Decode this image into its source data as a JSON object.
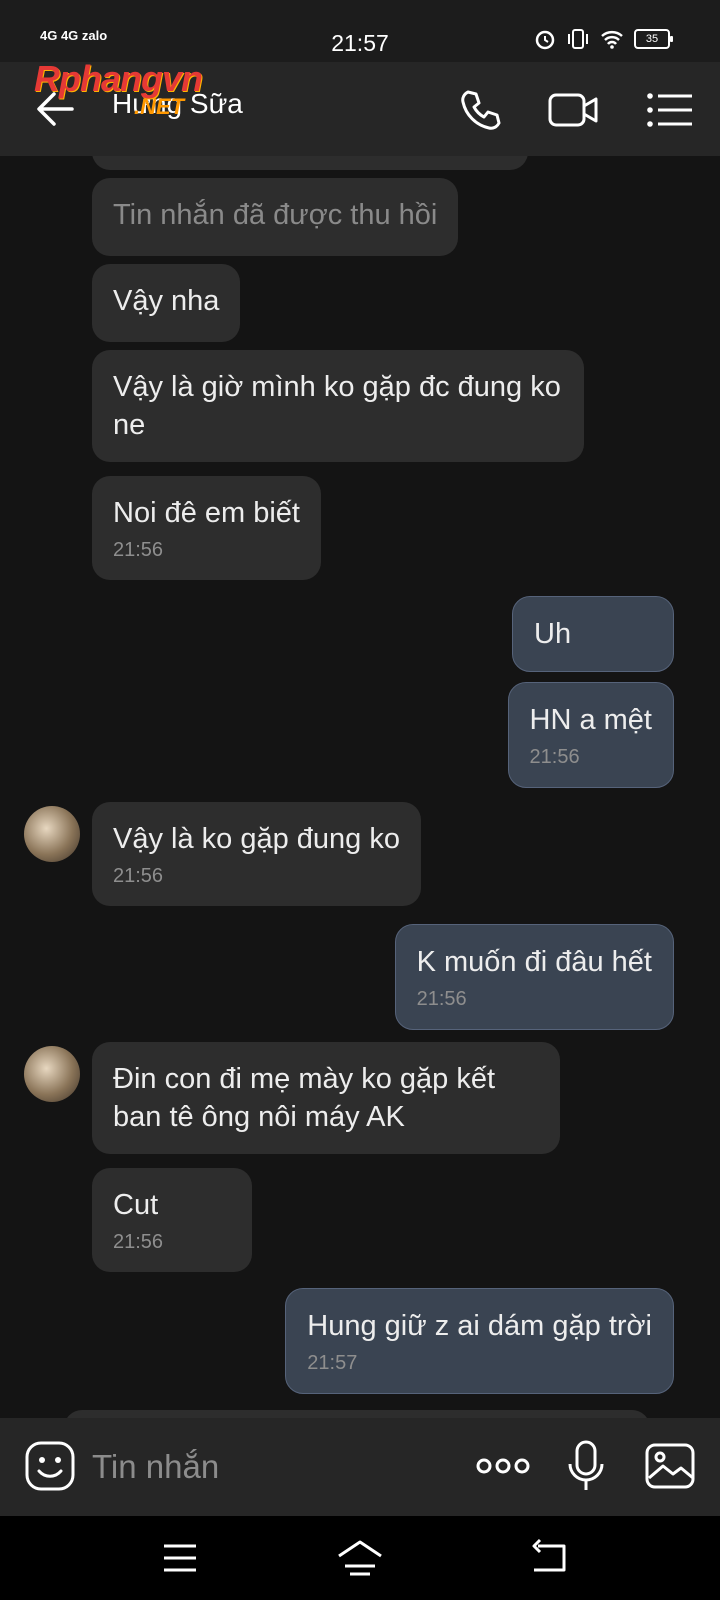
{
  "status_bar": {
    "left_indicators": "4G 4G zalo",
    "time": "21:57",
    "battery": "35"
  },
  "header": {
    "contact_name": "Hưng Sữa",
    "watermark": "Rphangvn",
    "watermark_sub": ".NET",
    "back_icon": "arrow-left-icon",
    "call_icon": "phone-icon",
    "video_icon": "video-camera-icon",
    "menu_icon": "list-menu-icon"
  },
  "messages": [
    {
      "dir": "in",
      "text": "Tin nhắn đã được thu hồi",
      "time": "",
      "recalled": true
    },
    {
      "dir": "in",
      "text": "Vậy nha",
      "time": ""
    },
    {
      "dir": "in",
      "text": "Vậy là giờ mình ko gặp đc đung ko ne",
      "time": ""
    },
    {
      "dir": "in",
      "text": "Noi đê em biết",
      "time": "21:56"
    },
    {
      "dir": "out",
      "text": "Uh",
      "time": ""
    },
    {
      "dir": "out",
      "text": "HN a mệt",
      "time": "21:56"
    },
    {
      "dir": "in",
      "text": "Vậy là ko gặp đung ko",
      "time": "21:56",
      "avatar": true
    },
    {
      "dir": "out",
      "text": "K muốn đi đâu hết",
      "time": "21:56"
    },
    {
      "dir": "in",
      "text": "Đin con đi mẹ mày ko gặp kết ban tê ông nôi máy AK",
      "time": "",
      "avatar": true
    },
    {
      "dir": "in",
      "text": "Cut",
      "time": "21:56"
    },
    {
      "dir": "out",
      "text": "Hung giữ z ai dám gặp trời",
      "time": "21:57"
    }
  ],
  "input": {
    "placeholder": "Tin nhắn",
    "emoji_icon": "emoji-icon",
    "more_icon": "more-dots-icon",
    "mic_icon": "microphone-icon",
    "image_icon": "image-icon"
  },
  "nav": {
    "menu_icon": "recent-apps-icon",
    "home_icon": "home-icon",
    "back_icon": "back-icon"
  },
  "colors": {
    "background": "#141414",
    "incoming_bubble": "#2d2d2d",
    "outgoing_bubble": "#3a4452",
    "header": "#262626"
  }
}
